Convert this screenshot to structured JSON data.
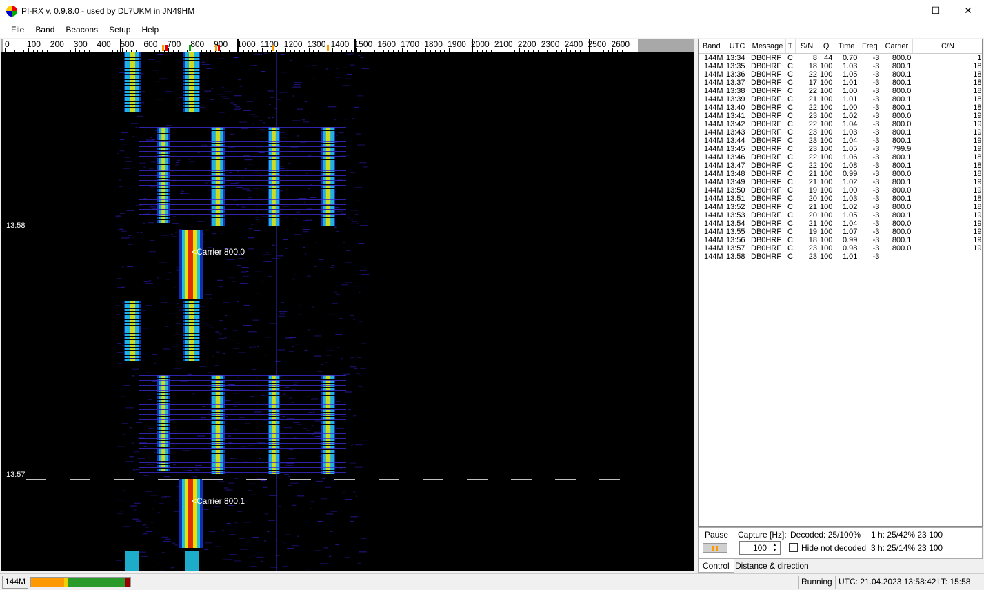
{
  "window": {
    "title": "PI-RX v. 0.9.8.0 - used by DL7UKM in JN49HM",
    "minimize": "—",
    "maximize": "☐",
    "close": "✕"
  },
  "menu": [
    "File",
    "Band",
    "Beacons",
    "Setup",
    "Help"
  ],
  "ruler": {
    "labels": [
      "0",
      "100",
      "200",
      "300",
      "400",
      "500",
      "600",
      "700",
      "800",
      "900",
      "1000",
      "1100",
      "1200",
      "1300",
      "1400",
      "1500",
      "1600",
      "1700",
      "1800",
      "1900",
      "2000",
      "2100",
      "2200",
      "2300",
      "2400",
      "2500",
      "2600"
    ]
  },
  "waterfall": {
    "time_labels": [
      "13:58",
      "13:57"
    ],
    "carrier_labels": [
      "<Carrier 800,0",
      "<Carrier 800,1"
    ]
  },
  "table": {
    "headers": [
      "Band",
      "UTC",
      "Message",
      "T",
      "S/N",
      "Q",
      "Time",
      "Freq",
      "Carrier",
      "C/N"
    ],
    "rows": [
      [
        "144M",
        "13:34",
        "DB0HRF",
        "C",
        "8",
        "44",
        "0.70",
        "-3",
        "800.0",
        "1"
      ],
      [
        "144M",
        "13:35",
        "DB0HRF",
        "C",
        "18",
        "100",
        "1.03",
        "-3",
        "800.1",
        "18"
      ],
      [
        "144M",
        "13:36",
        "DB0HRF",
        "C",
        "22",
        "100",
        "1.05",
        "-3",
        "800.1",
        "18"
      ],
      [
        "144M",
        "13:37",
        "DB0HRF",
        "C",
        "17",
        "100",
        "1.01",
        "-3",
        "800.1",
        "18"
      ],
      [
        "144M",
        "13:38",
        "DB0HRF",
        "C",
        "22",
        "100",
        "1.00",
        "-3",
        "800.0",
        "18"
      ],
      [
        "144M",
        "13:39",
        "DB0HRF",
        "C",
        "21",
        "100",
        "1.01",
        "-3",
        "800.1",
        "18"
      ],
      [
        "144M",
        "13:40",
        "DB0HRF",
        "C",
        "22",
        "100",
        "1.00",
        "-3",
        "800.1",
        "18"
      ],
      [
        "144M",
        "13:41",
        "DB0HRF",
        "C",
        "23",
        "100",
        "1.02",
        "-3",
        "800.0",
        "19"
      ],
      [
        "144M",
        "13:42",
        "DB0HRF",
        "C",
        "22",
        "100",
        "1.04",
        "-3",
        "800.0",
        "19"
      ],
      [
        "144M",
        "13:43",
        "DB0HRF",
        "C",
        "23",
        "100",
        "1.03",
        "-3",
        "800.1",
        "19"
      ],
      [
        "144M",
        "13:44",
        "DB0HRF",
        "C",
        "23",
        "100",
        "1.04",
        "-3",
        "800.1",
        "19"
      ],
      [
        "144M",
        "13:45",
        "DB0HRF",
        "C",
        "23",
        "100",
        "1.05",
        "-3",
        "799.9",
        "19"
      ],
      [
        "144M",
        "13:46",
        "DB0HRF",
        "C",
        "22",
        "100",
        "1.06",
        "-3",
        "800.1",
        "18"
      ],
      [
        "144M",
        "13:47",
        "DB0HRF",
        "C",
        "22",
        "100",
        "1.08",
        "-3",
        "800.1",
        "18"
      ],
      [
        "144M",
        "13:48",
        "DB0HRF",
        "C",
        "21",
        "100",
        "0.99",
        "-3",
        "800.0",
        "18"
      ],
      [
        "144M",
        "13:49",
        "DB0HRF",
        "C",
        "21",
        "100",
        "1.02",
        "-3",
        "800.1",
        "19"
      ],
      [
        "144M",
        "13:50",
        "DB0HRF",
        "C",
        "19",
        "100",
        "1.00",
        "-3",
        "800.0",
        "19"
      ],
      [
        "144M",
        "13:51",
        "DB0HRF",
        "C",
        "20",
        "100",
        "1.03",
        "-3",
        "800.1",
        "18"
      ],
      [
        "144M",
        "13:52",
        "DB0HRF",
        "C",
        "21",
        "100",
        "1.02",
        "-3",
        "800.0",
        "18"
      ],
      [
        "144M",
        "13:53",
        "DB0HRF",
        "C",
        "20",
        "100",
        "1.05",
        "-3",
        "800.1",
        "19"
      ],
      [
        "144M",
        "13:54",
        "DB0HRF",
        "C",
        "21",
        "100",
        "1.04",
        "-3",
        "800.0",
        "19"
      ],
      [
        "144M",
        "13:55",
        "DB0HRF",
        "C",
        "19",
        "100",
        "1.07",
        "-3",
        "800.0",
        "19"
      ],
      [
        "144M",
        "13:56",
        "DB0HRF",
        "C",
        "18",
        "100",
        "0.99",
        "-3",
        "800.1",
        "19"
      ],
      [
        "144M",
        "13:57",
        "DB0HRF",
        "C",
        "23",
        "100",
        "0.98",
        "-3",
        "800.0",
        "19"
      ],
      [
        "144M",
        "13:58",
        "DB0HRF",
        "C",
        "23",
        "100",
        "1.01",
        "-3",
        "",
        ""
      ]
    ]
  },
  "control": {
    "pause_label": "Pause",
    "capture_label": "Capture [Hz]:",
    "capture_value": "100",
    "decoded": "Decoded: 25/100%",
    "hide_label": "Hide not decoded",
    "stat_1h": "1 h: 25/42%  23  100",
    "stat_3h": "3 h: 25/14%  23  100"
  },
  "tabs": [
    "Control",
    "Distance & direction"
  ],
  "status": {
    "band": "144M",
    "running": "Running",
    "utc": "UTC:  21.04.2023  13:58:42",
    "lt": "LT:  15:58"
  },
  "colors": {
    "accent_orange": "#ff9900",
    "level_green": "#2a9a2a",
    "level_red": "#9a0000"
  }
}
